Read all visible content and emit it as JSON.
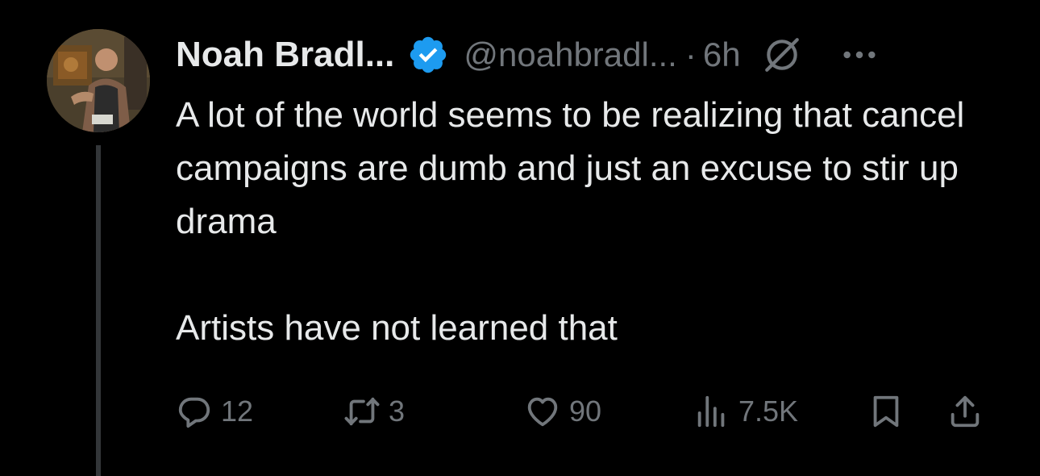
{
  "author": {
    "name": "Noah Bradl...",
    "handle": "@noahbradl...",
    "separator": "·",
    "time": "6h"
  },
  "tweet": {
    "paragraphs": [
      "A lot of the world seems to be realizing that cancel campaigns are dumb and just an excuse to stir up drama",
      "Artists have not learned that"
    ]
  },
  "actions": {
    "replies": "12",
    "reposts": "3",
    "likes": "90",
    "views": "7.5K"
  },
  "icons": {
    "verified": "verified-badge-icon",
    "reply_restriction": "reply-restricted-icon",
    "more": "more-icon",
    "reply": "reply-icon",
    "repost": "repost-icon",
    "like": "heart-icon",
    "views": "views-icon",
    "bookmark": "bookmark-icon",
    "share": "share-icon"
  },
  "colors": {
    "background": "#000000",
    "text": "#e7e9ea",
    "muted": "#71767b",
    "verified": "#1d9bf0",
    "thread_line": "#333639"
  }
}
